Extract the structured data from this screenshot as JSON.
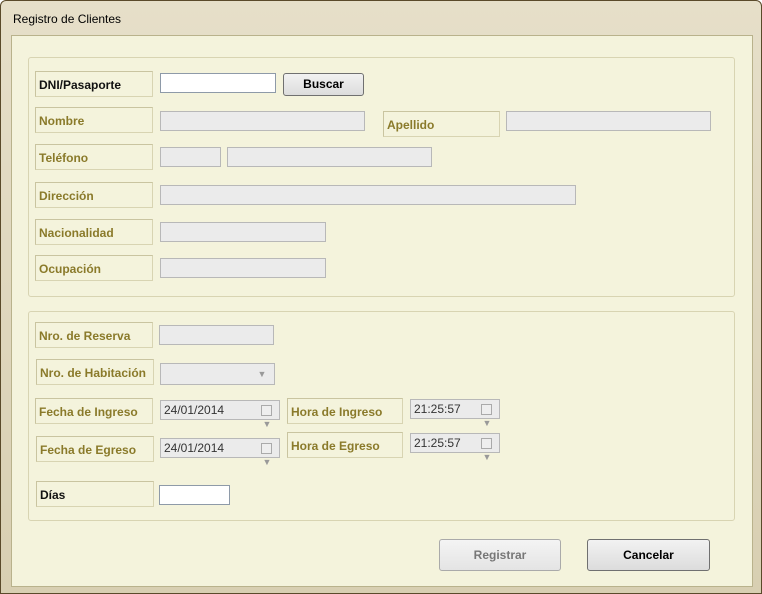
{
  "window": {
    "title": "Registro de Clientes"
  },
  "person": {
    "dni_label": "DNI/Pasaporte",
    "dni_value": "",
    "search_button": "Buscar",
    "name_label": "Nombre",
    "surname_label": "Apellido",
    "phone_label": "Teléfono",
    "address_label": "Dirección",
    "nationality_label": "Nacionalidad",
    "occupation_label": "Ocupación"
  },
  "booking": {
    "reservation_label": "Nro. de Reserva",
    "room_label": "Nro. de Habitación",
    "checkin_date_label": "Fecha de Ingreso",
    "checkin_date_value": "24/01/2014",
    "checkin_time_label": "Hora de Ingreso",
    "checkin_time_value": "21:25:57",
    "checkout_date_label": "Fecha de Egreso",
    "checkout_date_value": "24/01/2014",
    "checkout_time_label": "Hora de Egreso",
    "checkout_time_value": "21:25:57",
    "days_label": "Días",
    "days_value": ""
  },
  "actions": {
    "register_button": "Registrar",
    "cancel_button": "Cancelar"
  }
}
